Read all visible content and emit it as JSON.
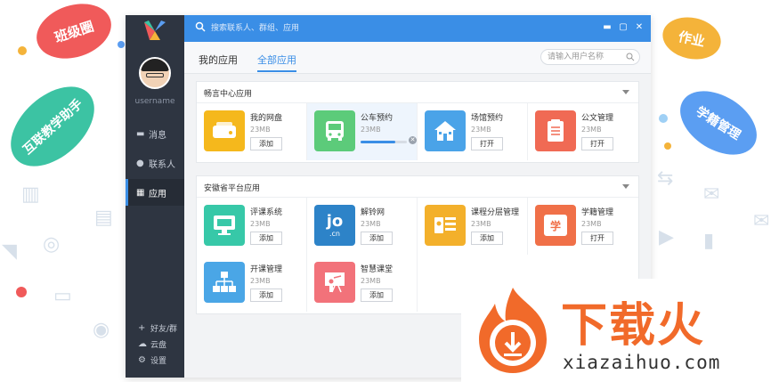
{
  "bubbles": [
    "班级圈",
    "互联教学助手",
    "作业",
    "学籍管理"
  ],
  "sidebar": {
    "username": "username",
    "nav": [
      {
        "label": "消息",
        "icon": "chat-icon"
      },
      {
        "label": "联系人",
        "icon": "person-icon"
      },
      {
        "label": "应用",
        "icon": "grid-icon",
        "active": true
      }
    ],
    "bottom": [
      {
        "label": "好友/群",
        "icon": "plus-icon"
      },
      {
        "label": "云盘",
        "icon": "cloud-icon"
      },
      {
        "label": "设置",
        "icon": "gear-icon"
      }
    ]
  },
  "topbar": {
    "search_placeholder": "搜索联系人、群组、应用"
  },
  "tabs": [
    {
      "label": "我的应用"
    },
    {
      "label": "全部应用",
      "active": true
    }
  ],
  "user_search": {
    "placeholder": "请输入用户名称"
  },
  "sections": [
    {
      "title": "畅言中心应用",
      "apps": [
        {
          "name": "我的网盘",
          "size": "23MB",
          "button": "添加",
          "color": "#f5b81c",
          "icon": "disk-icon"
        },
        {
          "name": "公车预约",
          "size": "23MB",
          "progress": 0.75,
          "color": "#5ccb7a",
          "icon": "bus-icon"
        },
        {
          "name": "场馆预约",
          "size": "23MB",
          "button": "打开",
          "color": "#4aa3e8",
          "icon": "house-icon"
        },
        {
          "name": "公文管理",
          "size": "23MB",
          "button": "打开",
          "color": "#f06a54",
          "icon": "document-icon"
        }
      ]
    },
    {
      "title": "安徽省平台应用",
      "apps": [
        {
          "name": "评课系统",
          "size": "23MB",
          "button": "添加",
          "color": "#37c8a8",
          "icon": "monitor-icon"
        },
        {
          "name": "解铃网",
          "size": "23MB",
          "button": "添加",
          "color": "#2d83c8",
          "icon": "jo-logo-icon",
          "logo_text": "jo",
          "logo_sub": ".cn"
        },
        {
          "name": "课程分层管理",
          "size": "23MB",
          "button": "添加",
          "color": "#f3b02b",
          "icon": "course-icon"
        },
        {
          "name": "学籍管理",
          "size": "23MB",
          "button": "打开",
          "color": "#f07048",
          "icon": "student-icon",
          "logo_text": "学"
        },
        {
          "name": "开课管理",
          "size": "23MB",
          "button": "添加",
          "color": "#4aa6e6",
          "icon": "network-icon"
        },
        {
          "name": "智慧课堂",
          "size": "23MB",
          "button": "添加",
          "color": "#f2727a",
          "icon": "teacher-icon"
        }
      ]
    }
  ],
  "watermark": {
    "text": "下载火",
    "url": "xiazaihuo.com"
  }
}
